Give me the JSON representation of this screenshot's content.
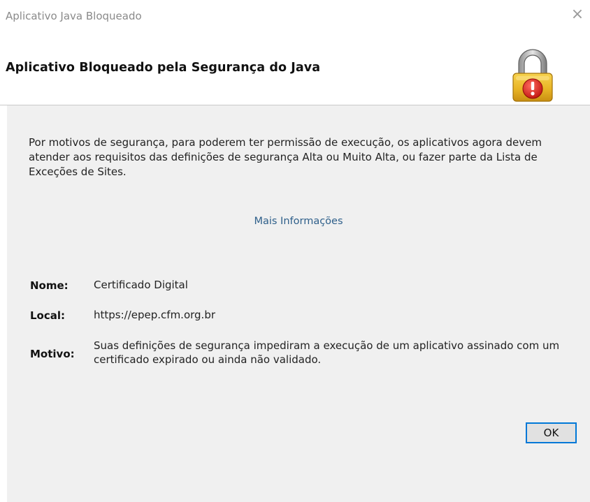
{
  "window": {
    "title": "Aplicativo Java Bloqueado",
    "close_glyph": "×"
  },
  "header": {
    "title": "Aplicativo Bloqueado pela Segurança do Java",
    "icon": "padlock-warning-icon"
  },
  "body": {
    "message": "Por motivos de segurança, para poderem ter permissão de execução, os aplicativos agora devem atender aos requisitos das definições de segurança Alta ou Muito Alta, ou fazer parte da Lista de Exceções de Sites.",
    "more_info_link": "Mais Informações"
  },
  "details": {
    "name_label": "Nome:",
    "name_value": "Certificado Digital",
    "location_label": "Local:",
    "location_value": "https://epep.cfm.org.br",
    "reason_label": "Motivo:",
    "reason_value": "Suas definições de segurança impediram a execução de um aplicativo assinado com um certificado expirado ou ainda não validado."
  },
  "buttons": {
    "ok_label": "OK"
  },
  "colors": {
    "content_background": "#f0f0f0",
    "link": "#2e5f8a",
    "focus_border": "#0078d7",
    "lock_gold": "#e9b526",
    "alert_red": "#d8231c"
  }
}
